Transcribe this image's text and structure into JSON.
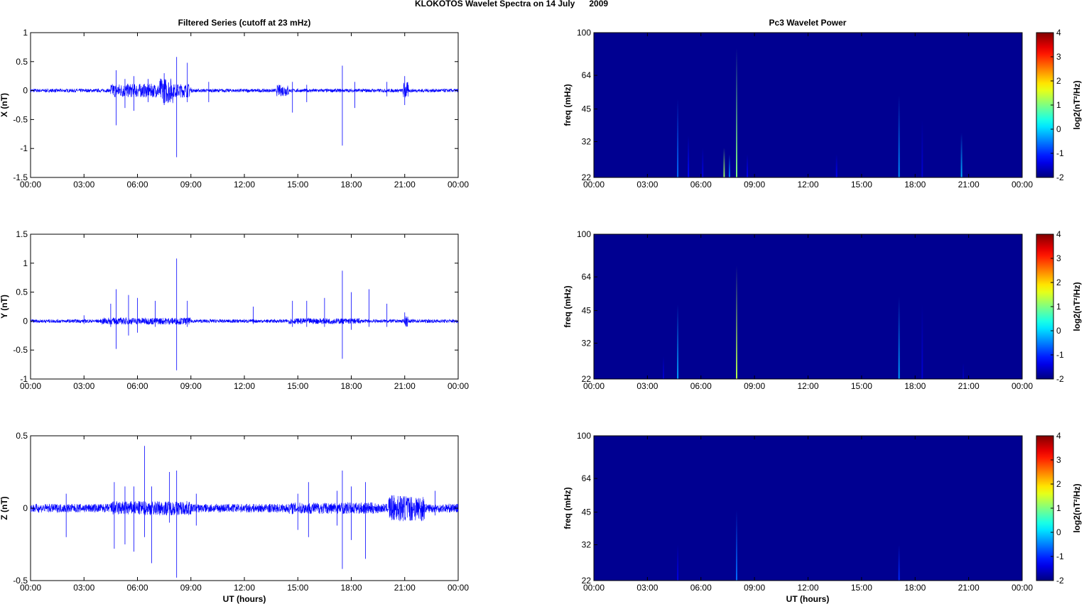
{
  "chart_data": {
    "title": "KLOKOTOS Wavelet Spectra on 14 July      2009",
    "left_title": "Filtered Series (cutoff at 23 mHz)",
    "right_title": "Pc3 Wavelet Power",
    "xlabel": "UT (hours)",
    "xticks": [
      "00:00",
      "03:00",
      "06:00",
      "09:00",
      "12:00",
      "15:00",
      "18:00",
      "21:00",
      "00:00"
    ],
    "xlim": [
      0,
      24
    ],
    "series": [
      {
        "type": "line",
        "name": "X",
        "ylabel": "X (nT)",
        "ylim": [
          -1.5,
          1
        ],
        "yticks": [
          "1",
          "0.5",
          "0",
          "-0.5",
          "-1",
          "-1.5"
        ],
        "ytickvals": [
          1,
          0.5,
          0,
          -0.5,
          -1,
          -1.5
        ],
        "color": "#0000ff",
        "activity": [
          [
            4.5,
            9.0,
            0.12
          ],
          [
            7.2,
            8.0,
            0.22
          ],
          [
            13.8,
            14.5,
            0.1
          ],
          [
            20.9,
            21.2,
            0.15
          ]
        ],
        "spikes": [
          [
            4.8,
            0.35,
            -0.6
          ],
          [
            5.3,
            0.2,
            -0.3
          ],
          [
            5.8,
            0.25,
            -0.35
          ],
          [
            6.6,
            0.2,
            -0.2
          ],
          [
            7.5,
            0.3,
            -0.25
          ],
          [
            8.2,
            0.58,
            -1.15
          ],
          [
            8.8,
            0.48,
            -0.2
          ],
          [
            10.0,
            0.15,
            -0.2
          ],
          [
            14.7,
            0.15,
            -0.38
          ],
          [
            15.5,
            0.1,
            -0.2
          ],
          [
            17.5,
            0.43,
            -0.95
          ],
          [
            18.2,
            0.15,
            -0.3
          ],
          [
            20.0,
            0.15,
            -0.1
          ],
          [
            21.0,
            0.25,
            -0.25
          ]
        ]
      },
      {
        "type": "line",
        "name": "Y",
        "ylabel": "Y (nT)",
        "ylim": [
          -1,
          1.5
        ],
        "yticks": [
          "1.5",
          "1",
          "0.5",
          "0",
          "-0.5",
          "-1"
        ],
        "ytickvals": [
          1.5,
          1,
          0.5,
          0,
          -0.5,
          -1
        ],
        "color": "#0000ff",
        "activity": [
          [
            4.0,
            9.0,
            0.06
          ],
          [
            14.5,
            18.5,
            0.05
          ],
          [
            21.0,
            21.2,
            0.1
          ]
        ],
        "spikes": [
          [
            3.0,
            0.1,
            -0.05
          ],
          [
            4.5,
            0.3,
            -0.1
          ],
          [
            4.8,
            0.55,
            -0.48
          ],
          [
            5.5,
            0.45,
            -0.25
          ],
          [
            6.0,
            0.4,
            -0.2
          ],
          [
            7.0,
            0.35,
            -0.1
          ],
          [
            8.2,
            1.08,
            -0.85
          ],
          [
            8.8,
            0.35,
            -0.1
          ],
          [
            12.5,
            0.25,
            -0.05
          ],
          [
            14.7,
            0.35,
            -0.1
          ],
          [
            15.5,
            0.35,
            -0.1
          ],
          [
            16.5,
            0.4,
            -0.1
          ],
          [
            17.5,
            0.87,
            -0.65
          ],
          [
            18.0,
            0.5,
            -0.15
          ],
          [
            19.0,
            0.55,
            -0.1
          ],
          [
            20.0,
            0.3,
            -0.1
          ],
          [
            21.0,
            0.15,
            -0.05
          ]
        ]
      },
      {
        "type": "line",
        "name": "Z",
        "ylabel": "Z (nT)",
        "ylim": [
          -0.5,
          0.5
        ],
        "yticks": [
          "0.5",
          "0",
          "-0.5"
        ],
        "ytickvals": [
          0.5,
          0,
          -0.5
        ],
        "color": "#0000ff",
        "activity": [
          [
            4.5,
            9.0,
            0.05
          ],
          [
            14.5,
            19.5,
            0.04
          ],
          [
            20.1,
            22.1,
            0.09
          ]
        ],
        "spikes": [
          [
            2.0,
            0.1,
            -0.2
          ],
          [
            4.7,
            0.18,
            -0.28
          ],
          [
            5.3,
            0.15,
            -0.25
          ],
          [
            5.8,
            0.15,
            -0.3
          ],
          [
            6.4,
            0.43,
            -0.2
          ],
          [
            6.8,
            0.15,
            -0.38
          ],
          [
            7.8,
            0.25,
            -0.1
          ],
          [
            8.2,
            0.26,
            -0.48
          ],
          [
            9.3,
            0.1,
            -0.12
          ],
          [
            15.0,
            0.1,
            -0.15
          ],
          [
            15.6,
            0.18,
            -0.2
          ],
          [
            17.2,
            0.12,
            -0.12
          ],
          [
            17.5,
            0.26,
            -0.42
          ],
          [
            18.0,
            0.15,
            -0.22
          ],
          [
            18.8,
            0.18,
            -0.35
          ],
          [
            22.7,
            0.12,
            -0.05
          ]
        ]
      },
      {
        "type": "heatmap",
        "name": "X spectrum",
        "ylabel": "freq (mHz)",
        "yticks": [
          "100",
          "64",
          "45",
          "32",
          "22"
        ],
        "ytickvals": [
          100,
          64,
          45,
          32,
          22
        ],
        "ylim": [
          22,
          100
        ],
        "yscale": "log",
        "streaks": [
          [
            4.7,
            50,
            -0.6
          ],
          [
            5.3,
            34,
            -1.2
          ],
          [
            6.1,
            30,
            -1.4
          ],
          [
            7.3,
            30,
            1.2
          ],
          [
            7.6,
            28,
            -0.5
          ],
          [
            8.0,
            85,
            1.0
          ],
          [
            8.6,
            28,
            -1.3
          ],
          [
            13.6,
            28,
            -1.3
          ],
          [
            17.1,
            52,
            -0.4
          ],
          [
            18.4,
            40,
            -1.5
          ],
          [
            20.6,
            35,
            -0.2
          ]
        ]
      },
      {
        "type": "heatmap",
        "name": "Y spectrum",
        "ylabel": "freq (mHz)",
        "yticks": [
          "100",
          "64",
          "45",
          "32",
          "22"
        ],
        "ytickvals": [
          100,
          64,
          45,
          32,
          22
        ],
        "ylim": [
          22,
          100
        ],
        "yscale": "log",
        "streaks": [
          [
            3.9,
            28,
            -1.5
          ],
          [
            4.7,
            48,
            -0.3
          ],
          [
            8.0,
            72,
            1.3
          ],
          [
            17.1,
            52,
            -0.3
          ],
          [
            18.4,
            48,
            -1.5
          ],
          [
            20.7,
            26,
            -1.6
          ]
        ]
      },
      {
        "type": "heatmap",
        "name": "Z spectrum",
        "ylabel": "freq (mHz)",
        "yticks": [
          "100",
          "64",
          "45",
          "32",
          "22"
        ],
        "ytickvals": [
          100,
          64,
          45,
          32,
          22
        ],
        "ylim": [
          22,
          100
        ],
        "yscale": "log",
        "streaks": [
          [
            4.7,
            32,
            -1.4
          ],
          [
            8.0,
            46,
            -0.6
          ],
          [
            17.1,
            32,
            -1.0
          ]
        ]
      }
    ],
    "colorbar": {
      "label": "log2(nT²/Hz)",
      "ticks": [
        "4",
        "3",
        "2",
        "1",
        "0",
        "-1",
        "-2"
      ],
      "range": [
        -2,
        4
      ],
      "colormap": "jet"
    }
  }
}
